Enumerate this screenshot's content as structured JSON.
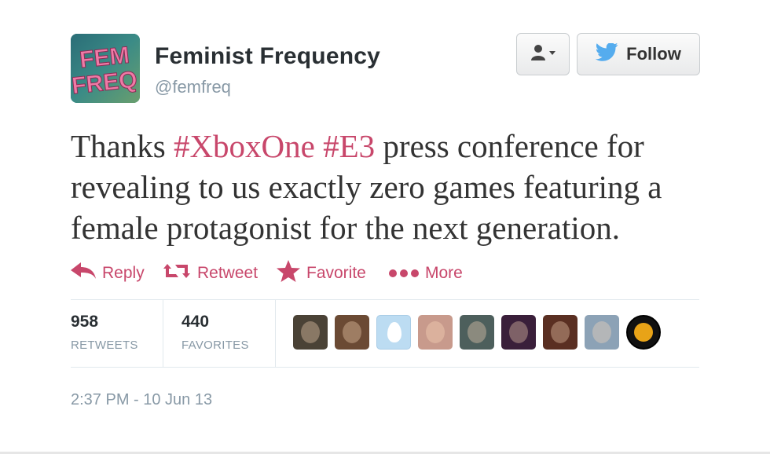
{
  "user": {
    "name": "Feminist Frequency",
    "handle": "@femfreq",
    "avatar_text_line1": "FEM",
    "avatar_text_line2": "FREQ"
  },
  "buttons": {
    "user_menu_icon": "user-dropdown-icon",
    "follow_label": "Follow",
    "follow_icon": "twitter-bird-icon"
  },
  "tweet": {
    "text_part1": "Thanks ",
    "hashtag1": "#XboxOne",
    "text_space": " ",
    "hashtag2": "#E3",
    "text_part2": " press conference for revealing to us exactly zero games featuring a female protagonist for the next generation."
  },
  "actions": [
    {
      "label": "Reply",
      "icon": "reply-arrow-icon"
    },
    {
      "label": "Retweet",
      "icon": "retweet-icon"
    },
    {
      "label": "Favorite",
      "icon": "star-icon"
    },
    {
      "label": "More",
      "icon": "more-dots-icon"
    }
  ],
  "stats": {
    "retweets_count": "958",
    "retweets_label": "RETWEETS",
    "favorites_count": "440",
    "favorites_label": "FAVORITES"
  },
  "retweeter_avatars": [
    {
      "color": "#4a4236"
    },
    {
      "color": "#6b4a34"
    },
    {
      "color": "#bcdcf2"
    },
    {
      "color": "#c89a8c"
    },
    {
      "color": "#4d5f5c"
    },
    {
      "color": "#3a1f3a"
    },
    {
      "color": "#5a2f22"
    },
    {
      "color": "#8ca2b6"
    },
    {
      "color": "#111111"
    }
  ],
  "timestamp": "2:37 PM - 10 Jun 13",
  "colors": {
    "accent": "#c8476b",
    "name": "#292f33",
    "muted": "#8899a6",
    "follow_bird": "#55acee"
  }
}
